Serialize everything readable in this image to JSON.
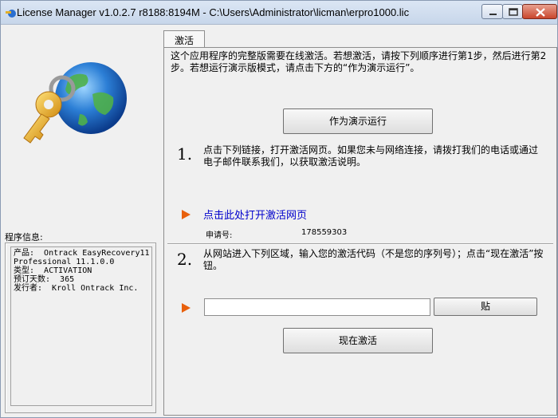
{
  "window": {
    "title": "License Manager v1.0.2.7 r8188:8194M - C:\\Users\\Administrator\\licman\\erpro1000.lic",
    "icons": {
      "app": "app-icon",
      "minimize": "minimize-icon",
      "maximize": "maximize-icon",
      "close": "close-icon"
    }
  },
  "left_panel": {
    "logo_icon": "key-globe-icon",
    "info_label": "程序信息:",
    "info_lines": [
      "产品:  Ontrack EasyRecovery11",
      "Professional 11.1.0.0",
      "类型:  ACTIVATION",
      "预订天数:  365",
      "发行者:  Kroll Ontrack Inc."
    ]
  },
  "tab": {
    "label": "激活"
  },
  "panel": {
    "intro": "这个应用程序的完整版需要在线激活。若想激活，请按下列顺序进行第1步，然后进行第2步。若想运行演示版模式，请点击下方的“作为演示运行”。",
    "demo_button": "作为演示运行",
    "step1": {
      "number": "1.",
      "text": "点击下列链接，打开激活网页。如果您未与网络连接，请拨打我们的电话或通过电子邮件联系我们，以获取激活说明。",
      "link": "点击此处打开激活网页",
      "request_label": "申请号:",
      "request_value": "178559303"
    },
    "step2": {
      "number": "2.",
      "text": "从网站进入下列区域，输入您的激活代码（不是您的序列号）；点击“现在激活”按钮。",
      "code_value": "",
      "paste_button": "贴",
      "activate_button": "现在激活"
    },
    "colors": {
      "arrow": "#e8600c",
      "link": "#0000cc"
    }
  }
}
